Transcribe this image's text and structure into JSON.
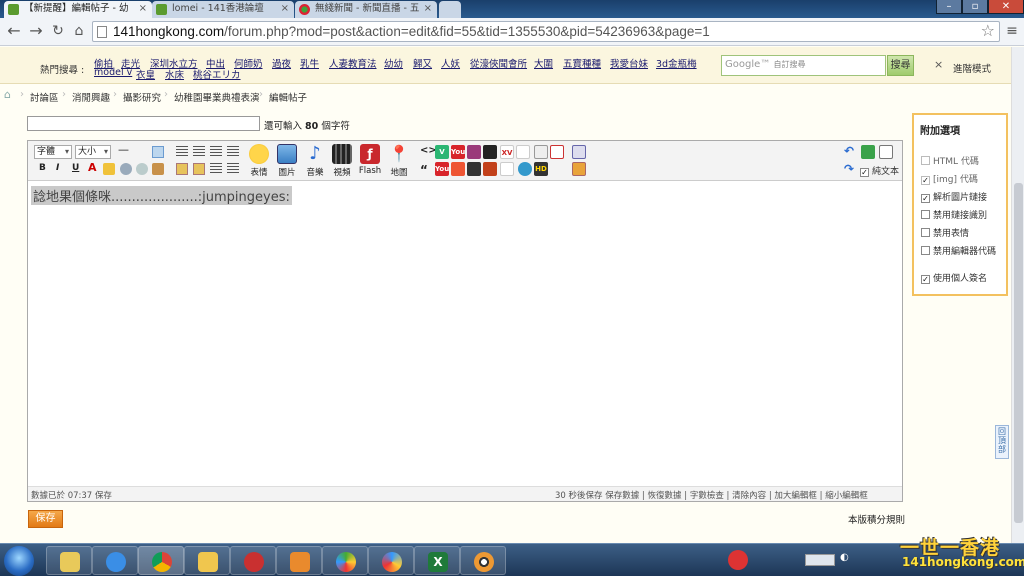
{
  "browser": {
    "tabs": [
      {
        "label": "【新提醒】編輯帖子 - 幼",
        "active": true
      },
      {
        "label": "lomei - 141香港論壇",
        "active": false
      },
      {
        "label": "無綫新聞 - 新聞直播 - 五",
        "active": false
      }
    ],
    "url_host": "141hongkong.com",
    "url_rest": "/forum.php?mod=post&action=edit&fid=55&tid=1355530&pid=54236963&page=1"
  },
  "hotsearch": {
    "label": "熱門搜尋 :",
    "row1": [
      "偷拍",
      "走光",
      "深圳水立方",
      "中出",
      "何師奶",
      "過夜",
      "乳牛",
      "人妻教育法",
      "幼幼",
      "歸又",
      "人妖",
      "從濠俠聞會所",
      "大圍",
      "五寶種種",
      "我愛台妹",
      "3d金瓶梅"
    ],
    "row2": [
      "model v",
      "衣皇",
      "水床",
      "桃谷エリカ"
    ],
    "google_placeholder": "Google",
    "google_sub": "自訂搜尋",
    "search_button": "搜尋",
    "close": "×",
    "advanced": "進階模式"
  },
  "breadcrumb": [
    "討論區",
    "消閒興趣",
    "攝影研究",
    "幼稚園畢業典禮表演",
    "編輯帖子"
  ],
  "subject": {
    "value": "",
    "remaining_prefix": "還可輸入",
    "remaining_count": "80",
    "remaining_suffix": "個字符"
  },
  "editor": {
    "font_select": "字體",
    "size_select": "大小",
    "bold": "B",
    "italic": "I",
    "underline": "U",
    "big_buttons": [
      "表情",
      "圖片",
      "音樂",
      "視頻",
      "Flash",
      "地圖"
    ],
    "plaintext_label": "純文本",
    "content": "諗地果個條咪.....................:jumpingeyes:",
    "status_left": "數據已於 07:37 保存",
    "status_links": [
      "30 秒後保存 保存數據",
      "恢復數據",
      "字數檢查",
      "清除內容",
      "加大編輯框",
      "縮小編輯框"
    ]
  },
  "options": {
    "title": "附加選項",
    "items": [
      {
        "label": "HTML 代碼",
        "checked": false,
        "disabled": true
      },
      {
        "label": "[img] 代碼",
        "checked": true,
        "disabled": true
      },
      {
        "label": "解析圖片鏈接",
        "checked": true,
        "disabled": false
      },
      {
        "label": "禁用鏈接識別",
        "checked": false,
        "disabled": false
      },
      {
        "label": "禁用表情",
        "checked": false,
        "disabled": false
      },
      {
        "label": "禁用編輯器代碼",
        "checked": false,
        "disabled": false
      },
      {
        "label": "使用個人簽名",
        "checked": true,
        "disabled": false
      }
    ]
  },
  "footer": {
    "save_button": "保存",
    "rules_link": "本版積分規則",
    "totop": "回頂部"
  },
  "watermark": {
    "line1": "一世一香港",
    "line2": "141hongkong.com"
  },
  "colors": {
    "accent_orange": "#e27a15",
    "panel_border": "#f3c15f",
    "hotbar_bg": "#fbf6df"
  }
}
